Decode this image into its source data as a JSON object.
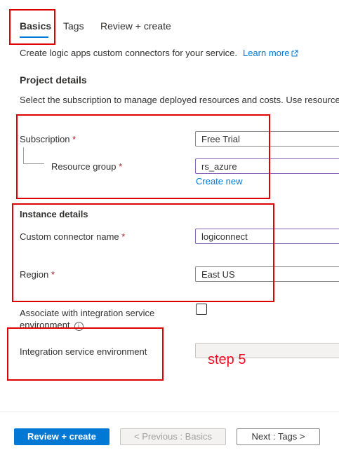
{
  "tabs": [
    {
      "label": "Basics"
    },
    {
      "label": "Tags"
    },
    {
      "label": "Review + create"
    }
  ],
  "description": "Create logic apps custom connectors for your service.",
  "learn_more": "Learn more",
  "project_details": {
    "title": "Project details",
    "help": "Select the subscription to manage deployed resources and costs. Use resource groups like folders to organize and manage all your resources.",
    "subscription_label": "Subscription",
    "subscription_value": "Free Trial",
    "resource_group_label": "Resource group",
    "resource_group_value": "rs_azure",
    "create_new": "Create new"
  },
  "instance_details": {
    "title": "Instance details",
    "connector_name_label": "Custom connector name",
    "connector_name_value": "logiconnect",
    "region_label": "Region",
    "region_value": "East US",
    "ise_checkbox_label": "Associate with integration service environment",
    "ise_label": "Integration service environment",
    "ise_value": ""
  },
  "required_mark": "*",
  "annotation": "step 5",
  "footer": {
    "review_create": "Review + create",
    "previous": "< Previous : Basics",
    "next": "Next : Tags >"
  },
  "colors": {
    "accent": "#0078d4",
    "annotation_red": "#e00000",
    "required": "#a4262c"
  }
}
